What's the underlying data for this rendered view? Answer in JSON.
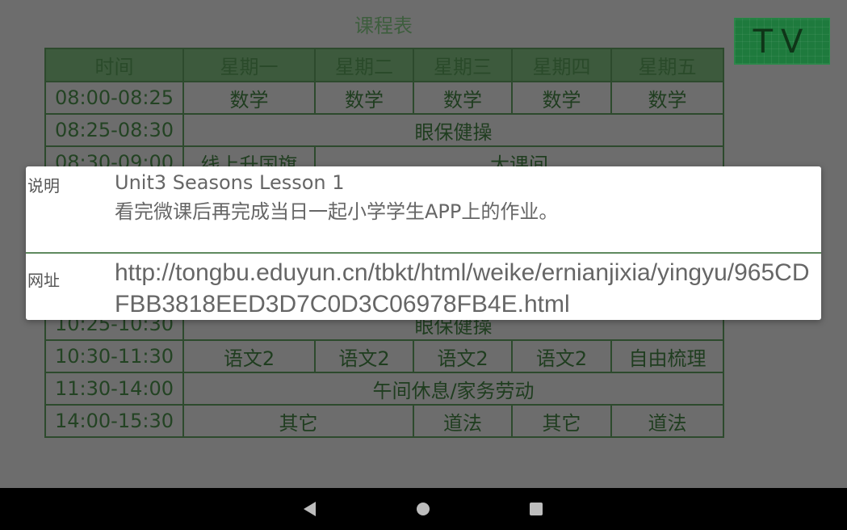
{
  "schedule": {
    "title": "课程表",
    "tv_label": "TV",
    "headers": [
      "时间",
      "星期一",
      "星期二",
      "星期三",
      "星期四",
      "星期五"
    ],
    "rows": [
      {
        "time": "08:00-08:25",
        "cells": [
          "数学",
          "数学",
          "数学",
          "数学",
          "数学"
        ]
      },
      {
        "time": "08:25-08:30",
        "merged": "眼保健操"
      },
      {
        "time": "08:30-09:00",
        "cells": [
          "线上升国旗"
        ],
        "merged": "大课间"
      },
      {
        "time": "10:25-10:30",
        "merged": "眼保健操"
      },
      {
        "time": "10:30-11:30",
        "cells": [
          "语文2",
          "语文2",
          "语文2",
          "语文2",
          "自由梳理"
        ]
      },
      {
        "time": "11:30-14:00",
        "merged": "午间休息/家务劳动"
      },
      {
        "time": "14:00-15:30",
        "cells": [
          "其它",
          "道法",
          "其它",
          "道法"
        ]
      }
    ]
  },
  "dialog": {
    "desc_label": "说明",
    "desc_line1": "Unit3 Seasons Lesson 1",
    "desc_line2": "看完微课后再完成当日一起小学学生APP上的作业。",
    "url_label": "网址",
    "url": "http://tongbu.eduyun.cn/tbkt/html/weike/ernianjixia/yingyu/965CDFBB3818EED3D7C0D3C06978FB4E.html"
  },
  "navbar": {
    "back_icon": "back-triangle-icon",
    "home_icon": "home-circle-icon",
    "recent_icon": "recents-square-icon"
  }
}
